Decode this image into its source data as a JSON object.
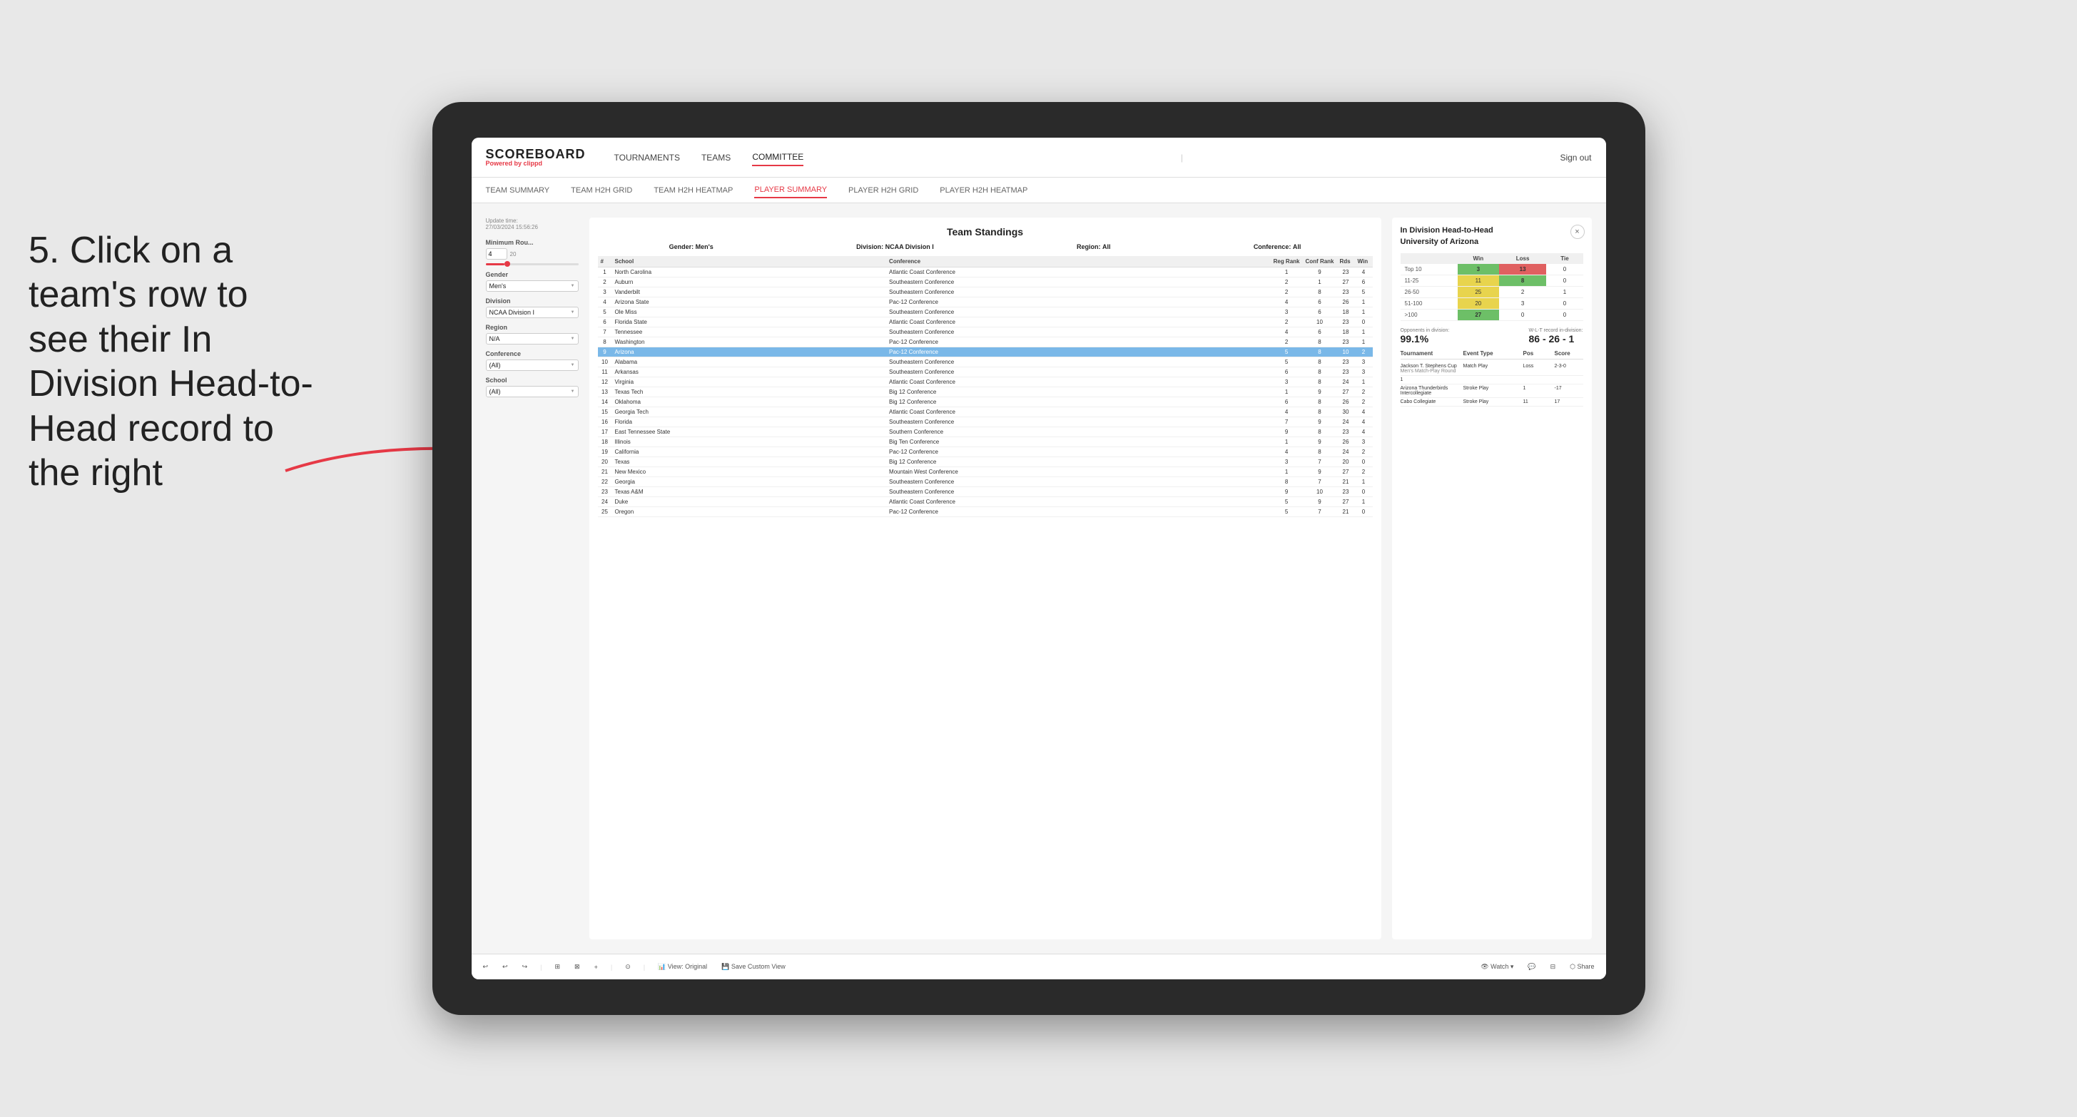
{
  "annotation": {
    "text": "5. Click on a team's row to see their In Division Head-to-Head record to the right"
  },
  "nav": {
    "logo_main": "SCOREBOARD",
    "logo_sub_prefix": "Powered by ",
    "logo_sub_brand": "clippd",
    "links": [
      "TOURNAMENTS",
      "TEAMS",
      "COMMITTEE"
    ],
    "active_link": "COMMITTEE",
    "sign_out_divider": "|",
    "sign_out": "Sign out"
  },
  "sub_nav": {
    "links": [
      "TEAM SUMMARY",
      "TEAM H2H GRID",
      "TEAM H2H HEATMAP",
      "PLAYER SUMMARY",
      "PLAYER H2H GRID",
      "PLAYER H2H HEATMAP"
    ],
    "active_link": "PLAYER SUMMARY"
  },
  "filters": {
    "update_time_label": "Update time:",
    "update_time_value": "27/03/2024 15:56:26",
    "min_rounds_label": "Minimum Rou...",
    "min_rounds_value": "4",
    "min_rounds_max": "20",
    "gender_label": "Gender",
    "gender_value": "Men's",
    "division_label": "Division",
    "division_value": "NCAA Division I",
    "region_label": "Region",
    "region_value": "N/A",
    "conference_label": "Conference",
    "conference_value": "(All)",
    "school_label": "School",
    "school_value": "(All)"
  },
  "standings": {
    "title": "Team Standings",
    "gender_label": "Gender:",
    "gender_value": "Men's",
    "division_label": "Division:",
    "division_value": "NCAA Division I",
    "region_label": "Region:",
    "region_value": "All",
    "conference_label": "Conference:",
    "conference_value": "All",
    "headers": [
      "#",
      "School",
      "Conference",
      "Reg Rank",
      "Conf Rank",
      "Rds",
      "Win"
    ],
    "rows": [
      {
        "rank": 1,
        "school": "North Carolina",
        "conference": "Atlantic Coast Conference",
        "reg_rank": 1,
        "conf_rank": 9,
        "rds": 23,
        "win": 4
      },
      {
        "rank": 2,
        "school": "Auburn",
        "conference": "Southeastern Conference",
        "reg_rank": 2,
        "conf_rank": 1,
        "rds": 27,
        "win": 6
      },
      {
        "rank": 3,
        "school": "Vanderbilt",
        "conference": "Southeastern Conference",
        "reg_rank": 2,
        "conf_rank": 8,
        "rds": 23,
        "win": 5
      },
      {
        "rank": 4,
        "school": "Arizona State",
        "conference": "Pac-12 Conference",
        "reg_rank": 4,
        "conf_rank": 6,
        "rds": 26,
        "win": 1
      },
      {
        "rank": 5,
        "school": "Ole Miss",
        "conference": "Southeastern Conference",
        "reg_rank": 3,
        "conf_rank": 6,
        "rds": 18,
        "win": 1
      },
      {
        "rank": 6,
        "school": "Florida State",
        "conference": "Atlantic Coast Conference",
        "reg_rank": 2,
        "conf_rank": 10,
        "rds": 23,
        "win": 0
      },
      {
        "rank": 7,
        "school": "Tennessee",
        "conference": "Southeastern Conference",
        "reg_rank": 4,
        "conf_rank": 6,
        "rds": 18,
        "win": 1
      },
      {
        "rank": 8,
        "school": "Washington",
        "conference": "Pac-12 Conference",
        "reg_rank": 2,
        "conf_rank": 8,
        "rds": 23,
        "win": 1
      },
      {
        "rank": 9,
        "school": "Arizona",
        "conference": "Pac-12 Conference",
        "reg_rank": 5,
        "conf_rank": 8,
        "rds": 10,
        "win": 2,
        "highlighted": true
      },
      {
        "rank": 10,
        "school": "Alabama",
        "conference": "Southeastern Conference",
        "reg_rank": 5,
        "conf_rank": 8,
        "rds": 23,
        "win": 3
      },
      {
        "rank": 11,
        "school": "Arkansas",
        "conference": "Southeastern Conference",
        "reg_rank": 6,
        "conf_rank": 8,
        "rds": 23,
        "win": 3
      },
      {
        "rank": 12,
        "school": "Virginia",
        "conference": "Atlantic Coast Conference",
        "reg_rank": 3,
        "conf_rank": 8,
        "rds": 24,
        "win": 1
      },
      {
        "rank": 13,
        "school": "Texas Tech",
        "conference": "Big 12 Conference",
        "reg_rank": 1,
        "conf_rank": 9,
        "rds": 27,
        "win": 2
      },
      {
        "rank": 14,
        "school": "Oklahoma",
        "conference": "Big 12 Conference",
        "reg_rank": 6,
        "conf_rank": 8,
        "rds": 26,
        "win": 2
      },
      {
        "rank": 15,
        "school": "Georgia Tech",
        "conference": "Atlantic Coast Conference",
        "reg_rank": 4,
        "conf_rank": 8,
        "rds": 30,
        "win": 4
      },
      {
        "rank": 16,
        "school": "Florida",
        "conference": "Southeastern Conference",
        "reg_rank": 7,
        "conf_rank": 9,
        "rds": 24,
        "win": 4
      },
      {
        "rank": 17,
        "school": "East Tennessee State",
        "conference": "Southern Conference",
        "reg_rank": 9,
        "conf_rank": 8,
        "rds": 23,
        "win": 4
      },
      {
        "rank": 18,
        "school": "Illinois",
        "conference": "Big Ten Conference",
        "reg_rank": 1,
        "conf_rank": 9,
        "rds": 26,
        "win": 3
      },
      {
        "rank": 19,
        "school": "California",
        "conference": "Pac-12 Conference",
        "reg_rank": 4,
        "conf_rank": 8,
        "rds": 24,
        "win": 2
      },
      {
        "rank": 20,
        "school": "Texas",
        "conference": "Big 12 Conference",
        "reg_rank": 3,
        "conf_rank": 7,
        "rds": 20,
        "win": 0
      },
      {
        "rank": 21,
        "school": "New Mexico",
        "conference": "Mountain West Conference",
        "reg_rank": 1,
        "conf_rank": 9,
        "rds": 27,
        "win": 2
      },
      {
        "rank": 22,
        "school": "Georgia",
        "conference": "Southeastern Conference",
        "reg_rank": 8,
        "conf_rank": 7,
        "rds": 21,
        "win": 1
      },
      {
        "rank": 23,
        "school": "Texas A&M",
        "conference": "Southeastern Conference",
        "reg_rank": 9,
        "conf_rank": 10,
        "rds": 23,
        "win": 0
      },
      {
        "rank": 24,
        "school": "Duke",
        "conference": "Atlantic Coast Conference",
        "reg_rank": 5,
        "conf_rank": 9,
        "rds": 27,
        "win": 1
      },
      {
        "rank": 25,
        "school": "Oregon",
        "conference": "Pac-12 Conference",
        "reg_rank": 5,
        "conf_rank": 7,
        "rds": 21,
        "win": 0
      }
    ]
  },
  "h2h": {
    "title": "In Division Head-to-Head",
    "team": "University of Arizona",
    "close_label": "×",
    "table_headers": [
      "",
      "Win",
      "Loss",
      "Tie"
    ],
    "rows": [
      {
        "label": "Top 10",
        "win": 3,
        "loss": 13,
        "tie": 0,
        "win_color": "green",
        "loss_color": "red"
      },
      {
        "label": "11-25",
        "win": 11,
        "loss": 8,
        "tie": 0,
        "win_color": "yellow",
        "loss_color": "green"
      },
      {
        "label": "26-50",
        "win": 25,
        "loss": 2,
        "tie": 1,
        "win_color": "yellow",
        "loss_color": ""
      },
      {
        "label": "51-100",
        "win": 20,
        "loss": 3,
        "tie": 0,
        "win_color": "yellow",
        "loss_color": ""
      },
      {
        "label": ">100",
        "win": 27,
        "loss": 0,
        "tie": 0,
        "win_color": "green",
        "loss_color": ""
      }
    ],
    "opponents_label": "Opponents in division:",
    "opponents_value": "99.1%",
    "wlt_label": "W-L-T record in-division:",
    "wlt_value": "86 - 26 - 1",
    "tournament_headers": [
      "Tournament",
      "Event Type",
      "Pos",
      "Score"
    ],
    "tournament_rows": [
      {
        "tournament": "Jackson T. Stephens Cup",
        "sub": "Men's Match-Play Round",
        "event_type": "Match Play",
        "pos": "Loss",
        "score": "2-3-0"
      },
      {
        "tournament": "1",
        "sub": "",
        "event_type": "",
        "pos": "",
        "score": ""
      },
      {
        "tournament": "Arizona Thunderbirds Intercollegiate",
        "sub": "",
        "event_type": "Stroke Play",
        "pos": "1",
        "score": "-17"
      },
      {
        "tournament": "Cabo Collegiate",
        "sub": "",
        "event_type": "Stroke Play",
        "pos": "11",
        "score": "17"
      }
    ]
  },
  "toolbar": {
    "buttons": [
      "↩",
      "↩",
      "↪",
      "⊞",
      "⊠",
      "+",
      "⊙",
      "View: Original",
      "Save Custom View",
      "👁 Watch",
      "⊡",
      "⊟",
      "Share"
    ]
  }
}
